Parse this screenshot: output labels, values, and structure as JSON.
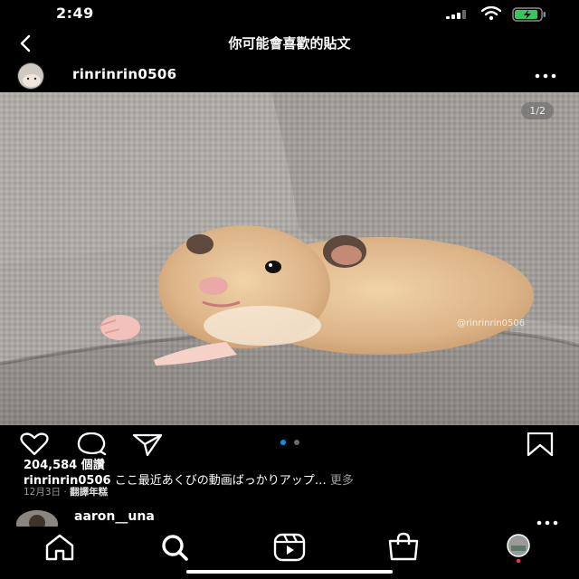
{
  "status_bar": {
    "time": "2:49",
    "icons": [
      "signal-icon",
      "wifi-icon",
      "battery-charging-icon"
    ]
  },
  "nav": {
    "back_icon": "chevron-left-icon",
    "title": "你可能會喜歡的貼文"
  },
  "post": {
    "username": "rinrinrin0506",
    "more_icon": "more-horizontal-icon",
    "photo": {
      "counter": "1/2",
      "watermark": "@rinrinrin0506",
      "current_index": 1,
      "total": 2
    },
    "actions": [
      "heart-icon",
      "comment-icon",
      "share-icon",
      "bookmark-icon"
    ],
    "likes": "204,584 個讚",
    "caption": {
      "user": "rinrinrin0506",
      "text": "ここ最近あくびの動画ばっかりアップ…",
      "more": "更多"
    },
    "date": "12月3日",
    "separator": "·",
    "translate": "翻譯年糕"
  },
  "next_post": {
    "username": "aaron__una"
  },
  "tab_bar": {
    "items": [
      "home-icon",
      "search-icon",
      "reels-icon",
      "shop-icon",
      "profile-icon"
    ],
    "active": "search-icon"
  },
  "colors": {
    "background": "#000000",
    "text": "#ffffff",
    "secondary_text": "#9b9b9b",
    "active_dot": "#0095f6",
    "notification_dot": "#ff3040"
  }
}
